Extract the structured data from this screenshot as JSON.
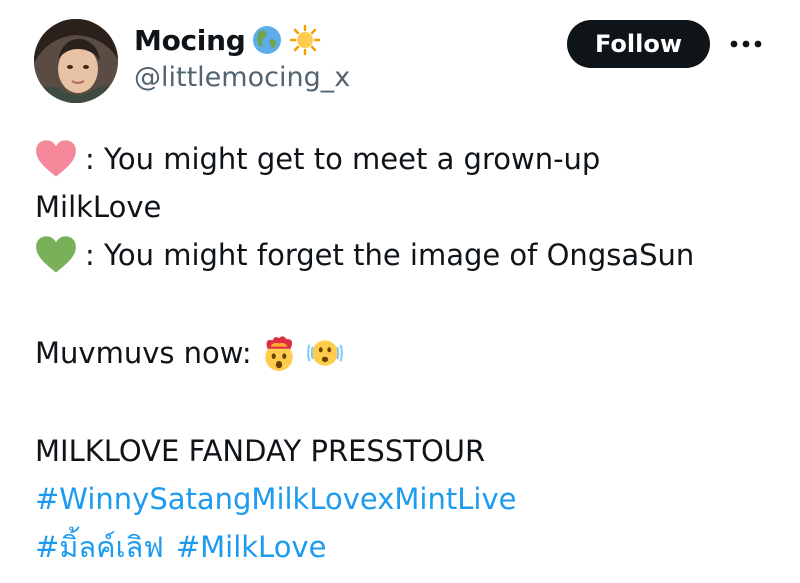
{
  "author": {
    "display_name": "Mocing",
    "name_emojis": [
      "globe-americas",
      "sun"
    ],
    "handle": "@littlemocing_x"
  },
  "actions": {
    "follow_label": "Follow"
  },
  "tweet": {
    "line1": ": You might get to meet a grown-up",
    "line2": "MilkLove",
    "line3": ": You might forget the image of OngsaSun",
    "line4": "Muvmuvs now:",
    "line5": "MILKLOVE FANDAY PRESSTOUR",
    "hashtag1": "#WinnySatangMilkLovexMintLive",
    "hashtag2": "#มิ้ลค์เลิฟ",
    "hashtag3": "#MilkLove"
  },
  "colors": {
    "link": "#1d9bf0",
    "pink_heart": "#f4889a",
    "green_heart": "#78b159",
    "follow_bg": "#0f1419",
    "handle_gray": "#536471"
  }
}
